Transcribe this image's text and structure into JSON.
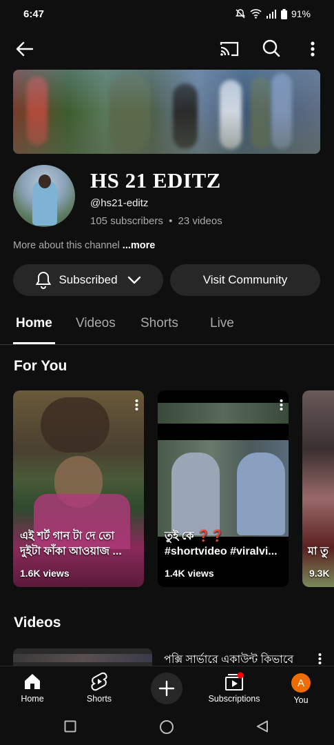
{
  "status_bar": {
    "time": "6:47",
    "battery": "91%"
  },
  "app_bar": {
    "back_icon": "arrow-left-icon",
    "cast_icon": "cast-icon",
    "search_icon": "search-icon",
    "more_icon": "more-vert-icon"
  },
  "channel": {
    "name": "HS 21 EDITZ",
    "handle": "@hs21-editz",
    "subscribers": "105 subscribers",
    "videos": "23 videos",
    "separator": "•",
    "more_about": "More about this channel",
    "more_link": "...more"
  },
  "actions": {
    "subscribed": "Subscribed",
    "visit_community": "Visit Community"
  },
  "tabs": [
    "Home",
    "Videos",
    "Shorts",
    "Live"
  ],
  "sections": {
    "for_you": "For You",
    "videos": "Videos"
  },
  "shorts": [
    {
      "caption": "এই শর্ট গান টা দে তো দুইটা ফাঁকা আওয়াজ ...",
      "views": "1.6K views"
    },
    {
      "caption": "তুই কে ❓❓ #shortvideo #viralvi...",
      "views": "1.4K views"
    },
    {
      "caption": "মা তু",
      "views": "9.3K"
    }
  ],
  "video": {
    "title": "পক্সি সার্ভারে একাউন্ট কিভাবে"
  },
  "bottom_nav": {
    "home": "Home",
    "shorts": "Shorts",
    "subscriptions": "Subscriptions",
    "you": "You",
    "you_initial": "A"
  },
  "colors": {
    "background": "#0f0f0f",
    "pill": "#272727",
    "muted_text": "#aaaaaa",
    "you_avatar": "#ef6c00",
    "notification_dot": "#ff0000"
  }
}
